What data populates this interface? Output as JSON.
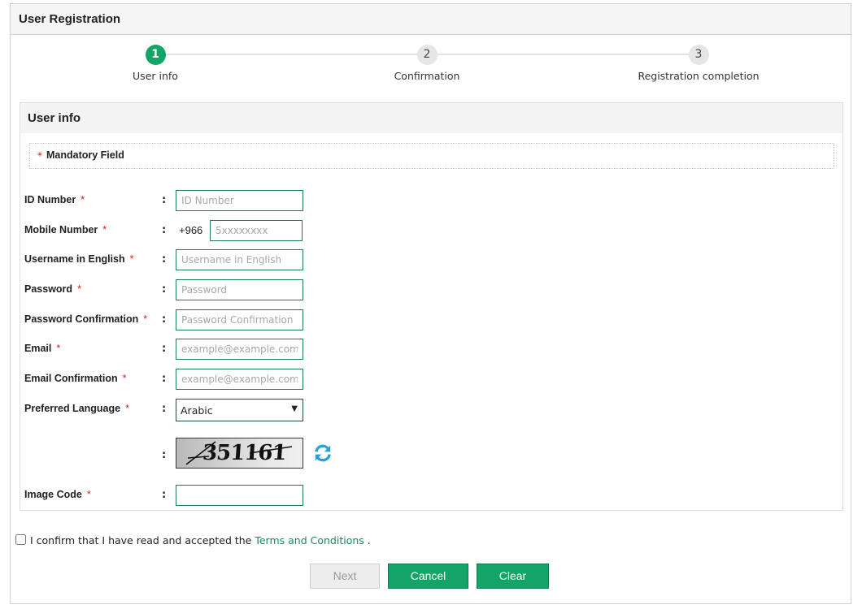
{
  "header": {
    "title": "User Registration"
  },
  "stepper": {
    "steps": [
      {
        "number": "1",
        "label": "User info",
        "active": true
      },
      {
        "number": "2",
        "label": "Confirmation",
        "active": false
      },
      {
        "number": "3",
        "label": "Registration completion",
        "active": false
      }
    ]
  },
  "section": {
    "title": "User info",
    "mandatory_star": "*",
    "mandatory_text": "Mandatory Field"
  },
  "form": {
    "required_mark": "*",
    "colon": ":",
    "id_number": {
      "label": "ID Number",
      "placeholder": "ID Number",
      "value": ""
    },
    "mobile_number": {
      "label": "Mobile Number",
      "prefix": "+966",
      "placeholder": "5xxxxxxxx",
      "value": ""
    },
    "username_en": {
      "label": "Username in English",
      "placeholder": "Username in English",
      "value": ""
    },
    "password": {
      "label": "Password",
      "placeholder": "Password",
      "value": ""
    },
    "password_confirm": {
      "label": "Password Confirmation",
      "placeholder": "Password Confirmation",
      "value": ""
    },
    "email": {
      "label": "Email",
      "placeholder": "example@example.com",
      "value": ""
    },
    "email_confirm": {
      "label": "Email Confirmation",
      "placeholder": "example@example.com",
      "value": ""
    },
    "preferred_language": {
      "label": "Preferred Language",
      "selected": "Arabic"
    },
    "captcha": {
      "code_shown": "351161",
      "refresh_icon": "refresh-icon"
    },
    "image_code": {
      "label": "Image Code",
      "value": ""
    }
  },
  "terms": {
    "checked": false,
    "text_before": "I confirm that I have read and accepted the ",
    "link_text": "Terms and Conditions",
    "text_after": " ."
  },
  "buttons": {
    "next": "Next",
    "cancel": "Cancel",
    "clear": "Clear"
  },
  "colors": {
    "accent": "#13a567",
    "field_border": "#1e7a55",
    "required": "#d21c1c",
    "link": "#1a8a5e",
    "refresh": "#2a9fd8"
  }
}
